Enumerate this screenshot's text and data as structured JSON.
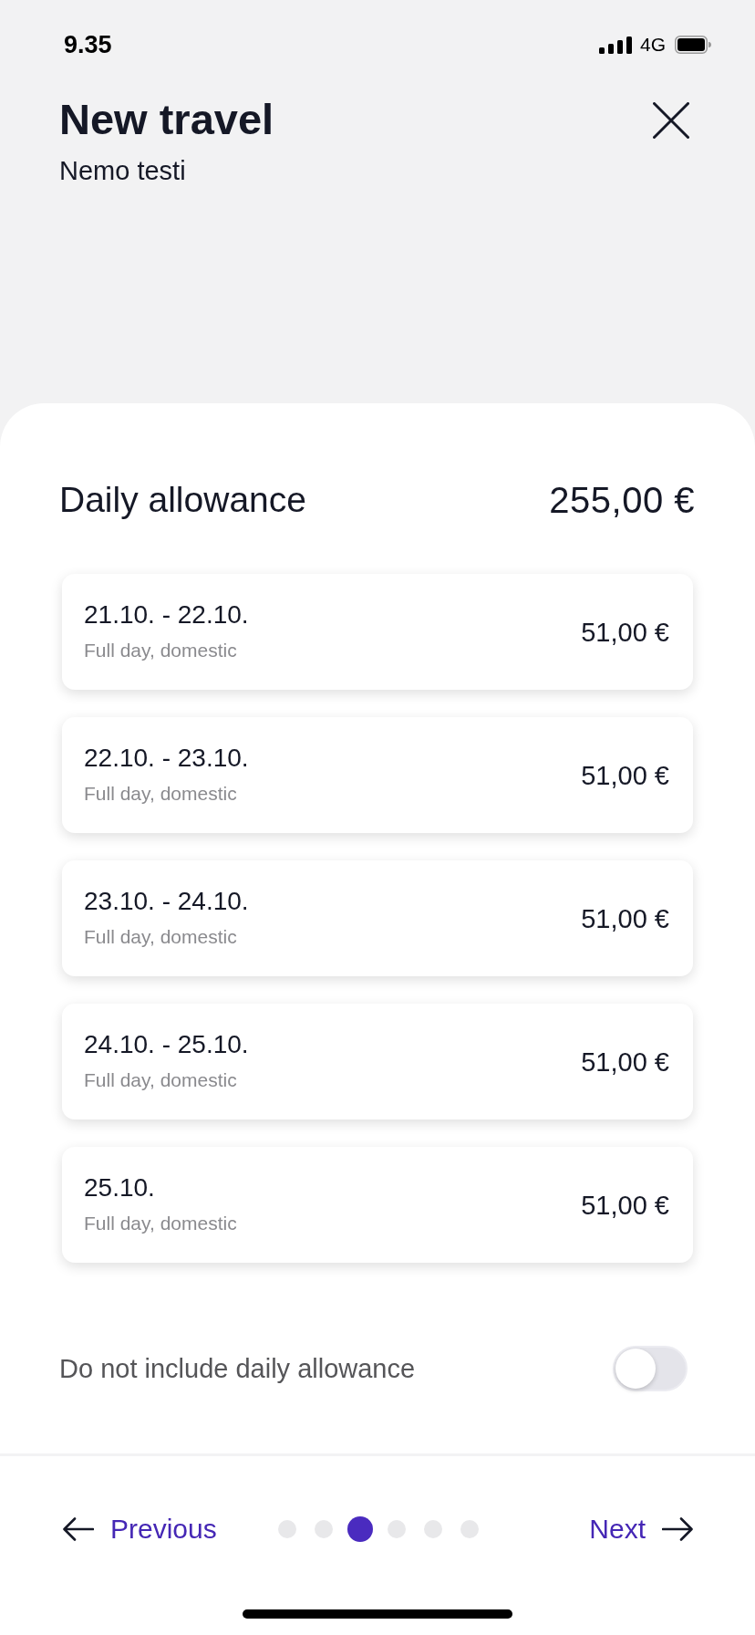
{
  "status_bar": {
    "time": "9.35",
    "network": "4G"
  },
  "header": {
    "title": "New travel",
    "subtitle": "Nemo testi"
  },
  "allowance": {
    "title": "Daily allowance",
    "total": "255,00 €",
    "days": [
      {
        "dates": "21.10. - 22.10.",
        "type": "Full day, domestic",
        "amount": "51,00 €"
      },
      {
        "dates": "22.10. - 23.10.",
        "type": "Full day, domestic",
        "amount": "51,00 €"
      },
      {
        "dates": "23.10. - 24.10.",
        "type": "Full day, domestic",
        "amount": "51,00 €"
      },
      {
        "dates": "24.10. - 25.10.",
        "type": "Full day, domestic",
        "amount": "51,00 €"
      },
      {
        "dates": "25.10.",
        "type": "Full day, domestic",
        "amount": "51,00 €"
      }
    ]
  },
  "exclude_toggle": {
    "label": "Do not include daily allowance",
    "on": false
  },
  "footer": {
    "previous": "Previous",
    "next": "Next",
    "steps": [
      {
        "selected": false
      },
      {
        "selected": false
      },
      {
        "selected": true
      },
      {
        "selected": false
      },
      {
        "selected": false
      },
      {
        "selected": false
      }
    ]
  }
}
